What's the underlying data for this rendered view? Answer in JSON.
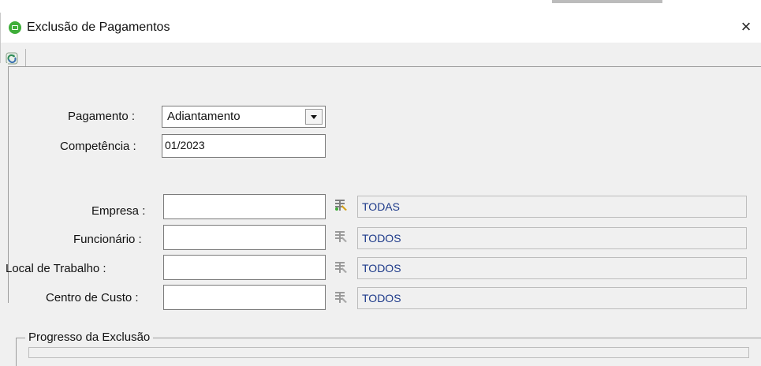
{
  "window": {
    "title": "Exclusão de Pagamentos",
    "close_glyph": "×"
  },
  "toolbar": {
    "refresh_icon": "recycle-icon"
  },
  "form": {
    "pagamento_label": "Pagamento :",
    "pagamento_value": "Adiantamento",
    "competencia_label": "Competência :",
    "competencia_value": "01/2023",
    "empresa_label": "Empresa :",
    "empresa_value": "",
    "empresa_desc": "TODAS",
    "funcionario_label": "Funcionário :",
    "funcionario_value": "",
    "funcionario_desc": "TODOS",
    "local_label": "Local  de Trabalho :",
    "local_value": "",
    "local_desc": "TODOS",
    "centro_label": "Centro de Custo :",
    "centro_value": "",
    "centro_desc": "TODOS"
  },
  "progress": {
    "group_title": "Progresso da Exclusão",
    "value": 0
  },
  "colors": {
    "app_icon": "#3fae3a",
    "desc_text": "#1d3a8a"
  }
}
